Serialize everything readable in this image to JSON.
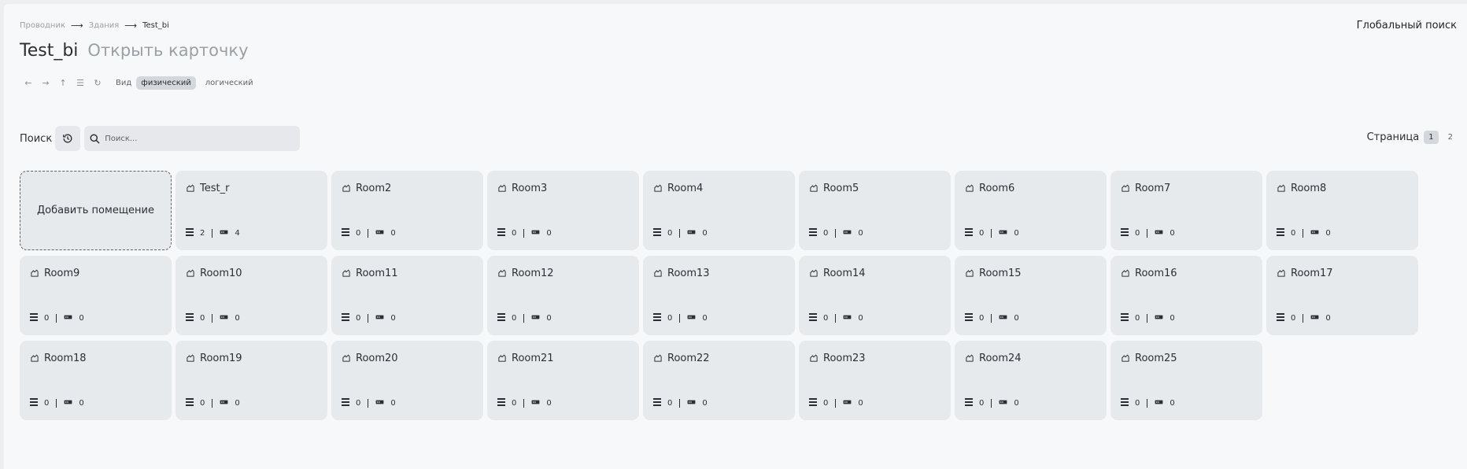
{
  "breadcrumb": [
    "Проводник",
    "Здания",
    "Test_bi"
  ],
  "global_search": "Глобальный поиск",
  "title": "Test_bi",
  "open_card": "Открыть карточку",
  "toolbar": {
    "icons": [
      "arrow-left-icon",
      "arrow-right-icon",
      "arrow-up-icon",
      "tree-icon",
      "refresh-icon"
    ],
    "view_label": "Вид",
    "view_physical": "физический",
    "view_logical": "логический"
  },
  "search": {
    "label": "Поиск",
    "placeholder": "Поиск..."
  },
  "pager": {
    "label": "Страница",
    "pages": [
      "1",
      "2"
    ],
    "current": "1"
  },
  "add_card_label": "Добавить помещение",
  "rooms": [
    {
      "name": "Test_r",
      "racks": "2",
      "devices": "4"
    },
    {
      "name": "Room2",
      "racks": "0",
      "devices": "0"
    },
    {
      "name": "Room3",
      "racks": "0",
      "devices": "0"
    },
    {
      "name": "Room4",
      "racks": "0",
      "devices": "0"
    },
    {
      "name": "Room5",
      "racks": "0",
      "devices": "0"
    },
    {
      "name": "Room6",
      "racks": "0",
      "devices": "0"
    },
    {
      "name": "Room7",
      "racks": "0",
      "devices": "0"
    },
    {
      "name": "Room8",
      "racks": "0",
      "devices": "0"
    },
    {
      "name": "Room9",
      "racks": "0",
      "devices": "0"
    },
    {
      "name": "Room10",
      "racks": "0",
      "devices": "0"
    },
    {
      "name": "Room11",
      "racks": "0",
      "devices": "0"
    },
    {
      "name": "Room12",
      "racks": "0",
      "devices": "0"
    },
    {
      "name": "Room13",
      "racks": "0",
      "devices": "0"
    },
    {
      "name": "Room14",
      "racks": "0",
      "devices": "0"
    },
    {
      "name": "Room15",
      "racks": "0",
      "devices": "0"
    },
    {
      "name": "Room16",
      "racks": "0",
      "devices": "0"
    },
    {
      "name": "Room17",
      "racks": "0",
      "devices": "0"
    },
    {
      "name": "Room18",
      "racks": "0",
      "devices": "0"
    },
    {
      "name": "Room19",
      "racks": "0",
      "devices": "0"
    },
    {
      "name": "Room20",
      "racks": "0",
      "devices": "0"
    },
    {
      "name": "Room21",
      "racks": "0",
      "devices": "0"
    },
    {
      "name": "Room22",
      "racks": "0",
      "devices": "0"
    },
    {
      "name": "Room23",
      "racks": "0",
      "devices": "0"
    },
    {
      "name": "Room24",
      "racks": "0",
      "devices": "0"
    },
    {
      "name": "Room25",
      "racks": "0",
      "devices": "0"
    }
  ]
}
